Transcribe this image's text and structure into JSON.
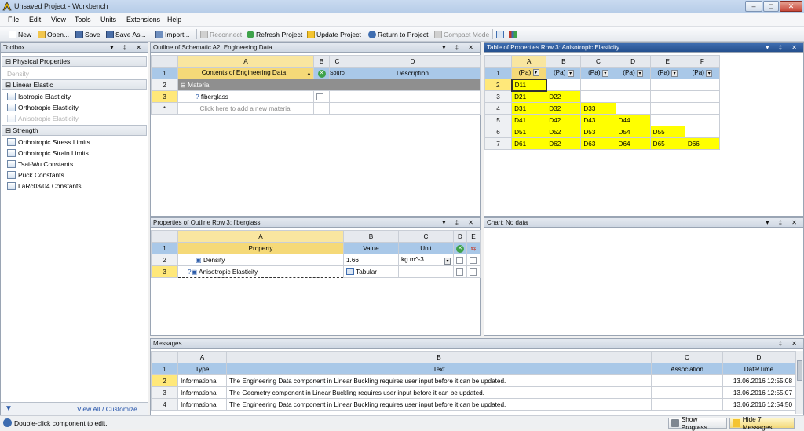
{
  "window": {
    "title": "Unsaved Project - Workbench",
    "min": "–",
    "max": "□",
    "close": "✕"
  },
  "menu": [
    "File",
    "Edit",
    "View",
    "Tools",
    "Units",
    "Extensions",
    "Help"
  ],
  "toolbar": {
    "new": "New",
    "open": "Open...",
    "save": "Save",
    "save_as": "Save As...",
    "import": "Import...",
    "reconnect": "Reconnect",
    "refresh": "Refresh Project",
    "update": "Update Project",
    "return": "Return to Project",
    "compact": "Compact Mode"
  },
  "toolbox": {
    "title": "Toolbox",
    "sections": [
      {
        "label": "Physical Properties",
        "items": [
          {
            "label": "Density",
            "disabled": true
          }
        ]
      },
      {
        "label": "Linear Elastic",
        "items": [
          {
            "label": "Isotropic Elasticity",
            "disabled": false
          },
          {
            "label": "Orthotropic Elasticity",
            "disabled": false
          },
          {
            "label": "Anisotropic Elasticity",
            "disabled": true
          }
        ]
      },
      {
        "label": "Strength",
        "items": [
          {
            "label": "Orthotropic Stress Limits"
          },
          {
            "label": "Orthotropic Strain Limits"
          },
          {
            "label": "Tsai-Wu Constants"
          },
          {
            "label": "Puck Constants"
          },
          {
            "label": "LaRc03/04 Constants"
          }
        ]
      }
    ],
    "footer": "View All / Customize..."
  },
  "outline": {
    "title": "Outline of Schematic A2: Engineering Data",
    "col_letters": [
      "A",
      "B",
      "C",
      "D"
    ],
    "headers": {
      "a": "Contents of Engineering Data",
      "c": "Source",
      "d": "Description"
    },
    "category": "Material",
    "material": "fiberglass",
    "add_new": "Click here to add a new material",
    "row_nums": [
      "1",
      "2",
      "3",
      "*"
    ]
  },
  "props_table": {
    "title": "Table of Properties Row 3: Anisotropic Elasticity",
    "col_letters": [
      "A",
      "B",
      "C",
      "D",
      "E",
      "F"
    ],
    "unit": "(Pa)",
    "rows": [
      [
        "D11"
      ],
      [
        "D21",
        "D22"
      ],
      [
        "D31",
        "D32",
        "D33"
      ],
      [
        "D41",
        "D42",
        "D43",
        "D44"
      ],
      [
        "D51",
        "D52",
        "D53",
        "D54",
        "D55"
      ],
      [
        "D61",
        "D62",
        "D63",
        "D64",
        "D65",
        "D66"
      ]
    ]
  },
  "properties": {
    "title": "Properties of Outline Row 3: fiberglass",
    "col_letters": [
      "A",
      "B",
      "C",
      "D",
      "E"
    ],
    "headers": {
      "property": "Property",
      "value": "Value",
      "unit": "Unit"
    },
    "rows": [
      {
        "num": "2",
        "property": "Density",
        "value": "1.66",
        "unit": "kg m^-3"
      },
      {
        "num": "3",
        "property": "Anisotropic Elasticity",
        "value": "Tabular",
        "unit": ""
      }
    ]
  },
  "chart": {
    "title": "Chart: No data"
  },
  "messages": {
    "title": "Messages",
    "col_letters": [
      "A",
      "B",
      "C",
      "D"
    ],
    "headers": {
      "type": "Type",
      "text": "Text",
      "assoc": "Association",
      "date": "Date/Time"
    },
    "rows": [
      {
        "num": "2",
        "type": "Informational",
        "text": "The Engineering Data component in Linear Buckling requires user input before it can be updated.",
        "date": "13.06.2016 12:55:08"
      },
      {
        "num": "3",
        "type": "Informational",
        "text": "The Geometry component in Linear Buckling requires user input before it can be updated.",
        "date": "13.06.2016 12:55:07"
      },
      {
        "num": "4",
        "type": "Informational",
        "text": "The Engineering Data component in Linear Buckling requires user input before it can be updated.",
        "date": "13.06.2016 12:54:50"
      }
    ]
  },
  "status": {
    "text": "Double-click component to edit.",
    "show_progress": "Show Progress",
    "hide_messages": "Hide 7 Messages"
  }
}
